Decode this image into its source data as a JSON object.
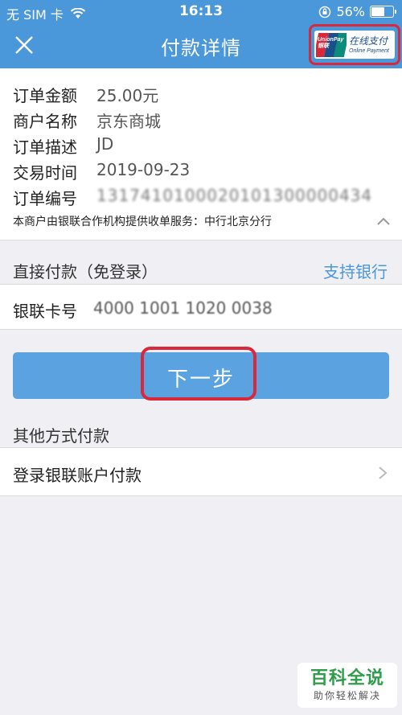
{
  "status_bar": {
    "carrier": "无 SIM 卡",
    "time": "16:13",
    "battery": "56%",
    "battery_level": 0.56
  },
  "nav": {
    "title": "付款详情",
    "close_icon": "close-icon",
    "logo_brand": "UnionPay",
    "logo_brand_cn": "银联",
    "logo_cn": "在线支付",
    "logo_en": "Online Payment"
  },
  "order": {
    "rows": [
      {
        "label": "订单金额",
        "value": "25.00元"
      },
      {
        "label": "商户名称",
        "value": "京东商城"
      },
      {
        "label": "订单描述",
        "value": "JD"
      },
      {
        "label": "交易时间",
        "value": "2019-09-23"
      },
      {
        "label": "订单编号",
        "value": "1317410100020101300000434"
      }
    ],
    "service_note": "本商户由银联合作机构提供收单服务：中行北京分行"
  },
  "direct_pay": {
    "header": "直接付款（免登录）",
    "support_link": "支持银行",
    "card_label": "银联卡号",
    "card_value": "4000 1001 1020 0038"
  },
  "next_button": {
    "label": "下一步"
  },
  "other": {
    "header": "其他方式付款",
    "login_label": "登录银联账户付款"
  },
  "watermark": {
    "main": "百科全说",
    "sub": "助你轻松解决"
  },
  "colors": {
    "primary": "#4a97d9",
    "button": "#5ba3e0",
    "highlight": "#d8283a",
    "watermark": "#2e9e4a"
  }
}
